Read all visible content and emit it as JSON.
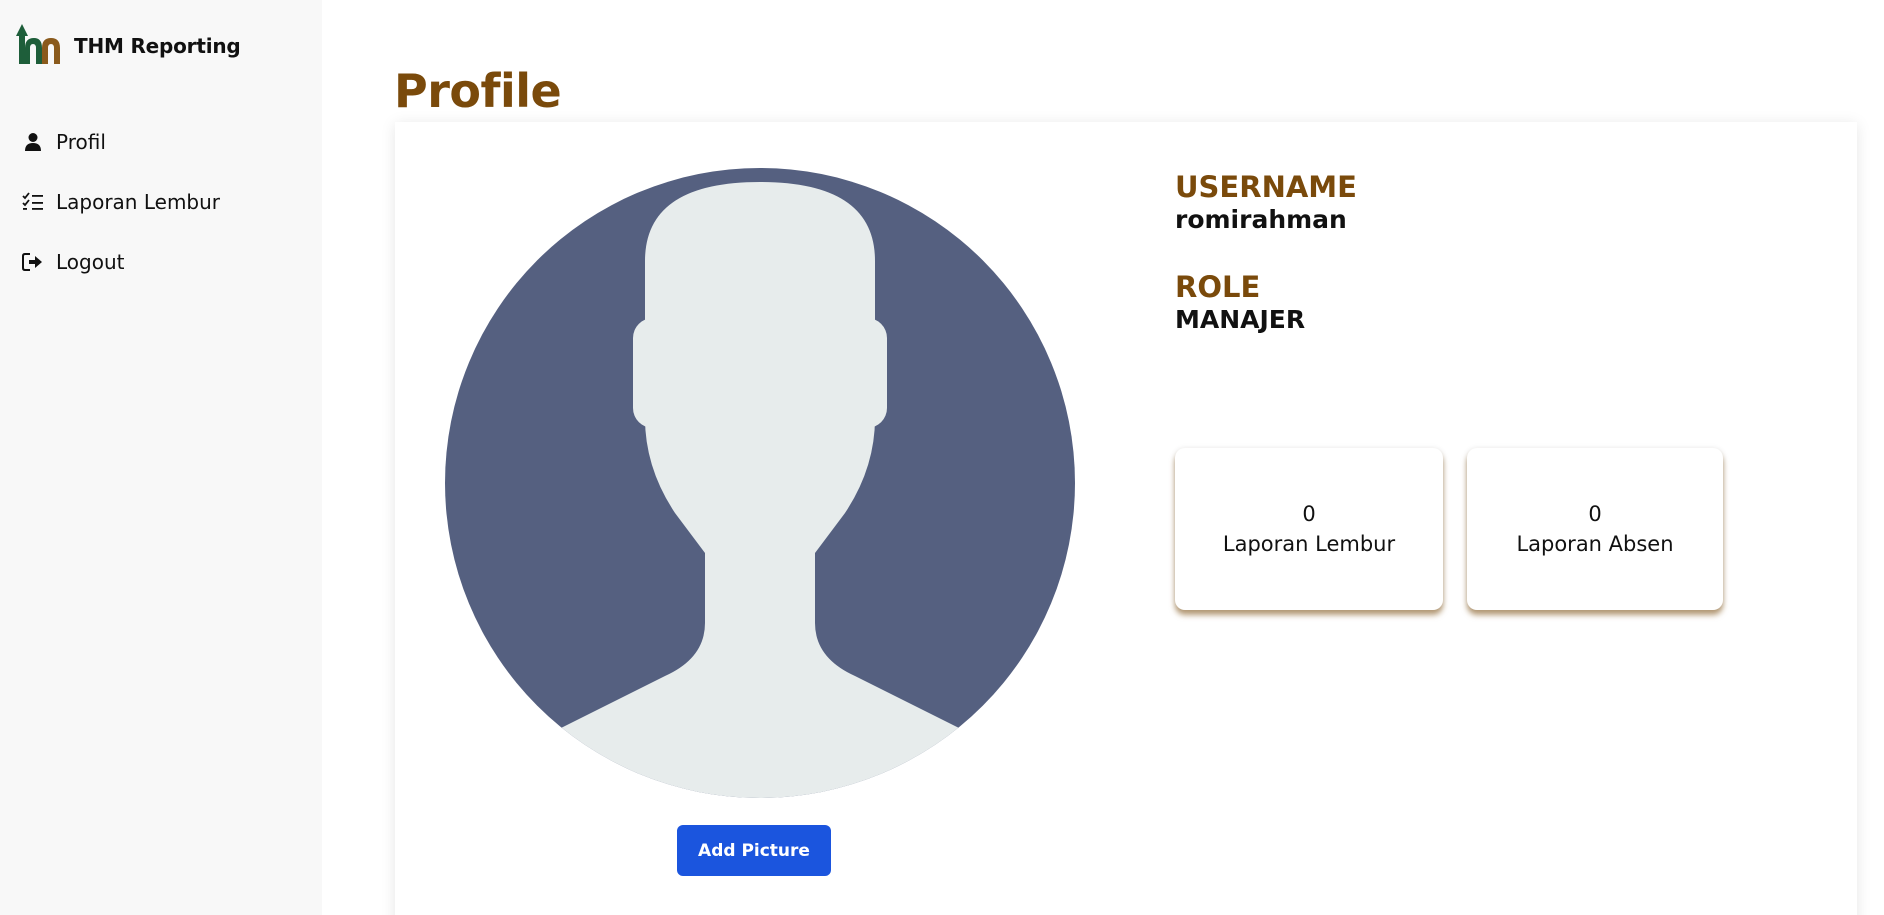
{
  "brand": {
    "name": "THM Reporting"
  },
  "sidebar": {
    "items": [
      {
        "label": "Profil",
        "icon": "user-icon"
      },
      {
        "label": "Laporan Lembur",
        "icon": "checklist-icon"
      },
      {
        "label": "Logout",
        "icon": "logout-icon"
      }
    ]
  },
  "page": {
    "title": "Profile"
  },
  "profile": {
    "username_label": "USERNAME",
    "username": "romirahman",
    "role_label": "ROLE",
    "role": "MANAJER",
    "add_picture_label": "Add Picture"
  },
  "stats": [
    {
      "value": "0",
      "label": "Laporan Lembur"
    },
    {
      "value": "0",
      "label": "Laporan Absen"
    }
  ],
  "colors": {
    "accent_brown": "#7a4a0b",
    "button_blue": "#1b55de",
    "avatar_bg": "#556080",
    "avatar_silhouette": "#e7ecec",
    "logo_green": "#1e5e3a",
    "sidebar_bg": "#f8f8f8"
  }
}
